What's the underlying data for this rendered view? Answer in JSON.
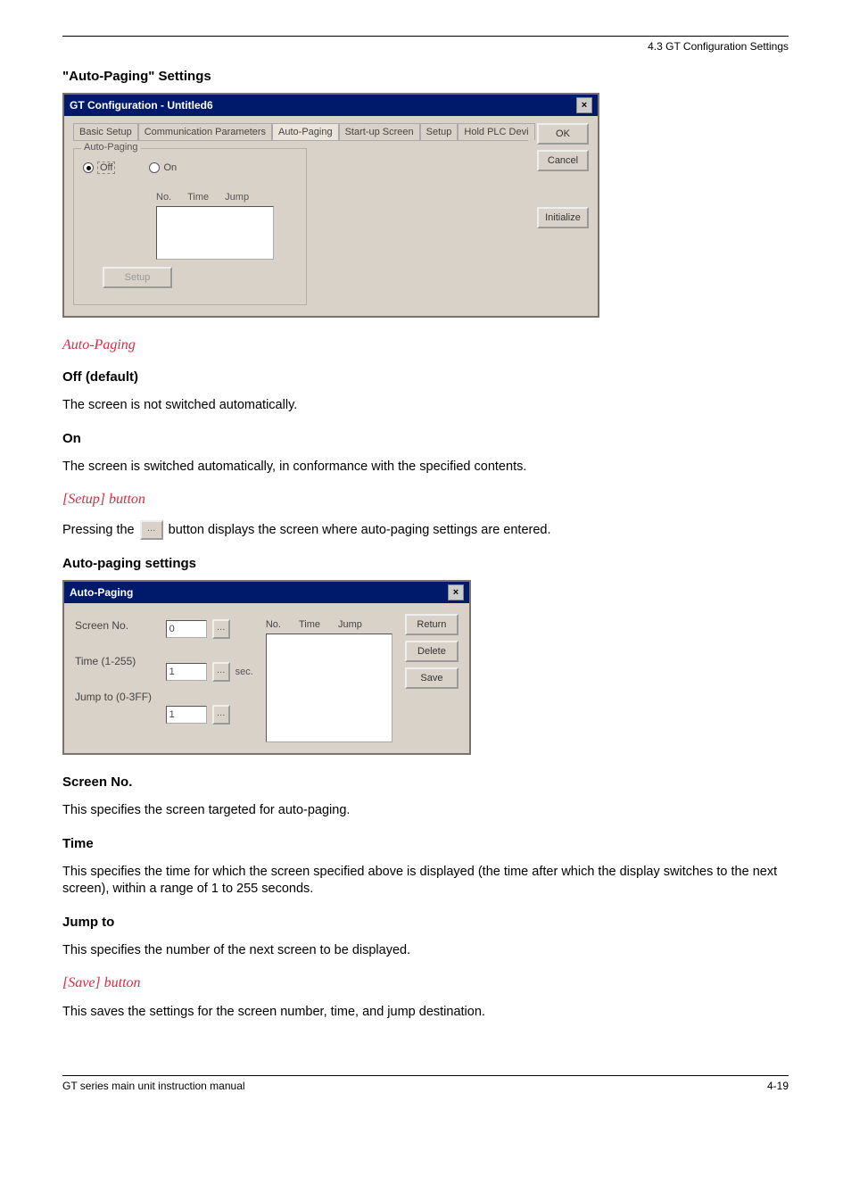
{
  "page": {
    "header_right": "4.3 GT Configuration Settings",
    "section_header": "\"Auto-Paging\" Settings",
    "footer_left": "GT series main unit instruction manual",
    "footer_right": "4-19"
  },
  "win1": {
    "title": "GT Configuration - Untitled6",
    "buttons": {
      "ok": "OK",
      "cancel": "Cancel",
      "initialize": "Initialize"
    },
    "tabs": {
      "basic": "Basic Setup",
      "comm": "Communication Parameters",
      "auto": "Auto-Paging",
      "startup": "Start-up Screen",
      "setup": "Setup",
      "hold": "Hold PLC Devi"
    },
    "autopaging": {
      "legend": "Auto-Paging",
      "off": "Off",
      "on": "On",
      "cols": {
        "no": "No.",
        "time": "Time",
        "jump": "Jump"
      },
      "setup_btn": "Setup"
    }
  },
  "body": {
    "h_autopaging": "Auto-Paging",
    "h_off": "Off (default)",
    "p_off": "The screen is not switched automatically.",
    "h_on": "On",
    "p_on": "The screen is switched automatically, in conformance with the specified contents.",
    "h_setup": "[Setup] button",
    "p_setup_pre": "Pressing the",
    "p_setup_post": "button displays the screen where auto-paging settings are entered.",
    "h_autopaging_settings": "Auto-paging settings",
    "h_screen_no": "Screen No.",
    "p_screen_no": "This specifies the screen targeted for auto-paging.",
    "h_time": "Time",
    "p_time": "This specifies the time for which the screen specified above is displayed (the time after which the display switches to the next screen), within a range of 1 to 255 seconds.",
    "h_jump": "Jump to",
    "p_jump": "This specifies the number of the next screen to be displayed.",
    "h_save": "[Save] button",
    "p_save": "This saves the settings for the screen number, time, and jump destination."
  },
  "win2": {
    "title": "Auto-Paging",
    "labels": {
      "screen_no": "Screen No.",
      "time": "Time (1-255)",
      "jump": "Jump to (0-3FF)",
      "sec": "sec."
    },
    "values": {
      "screen_no": "0",
      "time": "1",
      "jump": "1"
    },
    "cols": {
      "no": "No.",
      "time": "Time",
      "jump": "Jump"
    },
    "buttons": {
      "return": "Return",
      "delete": "Delete",
      "save": "Save"
    }
  }
}
